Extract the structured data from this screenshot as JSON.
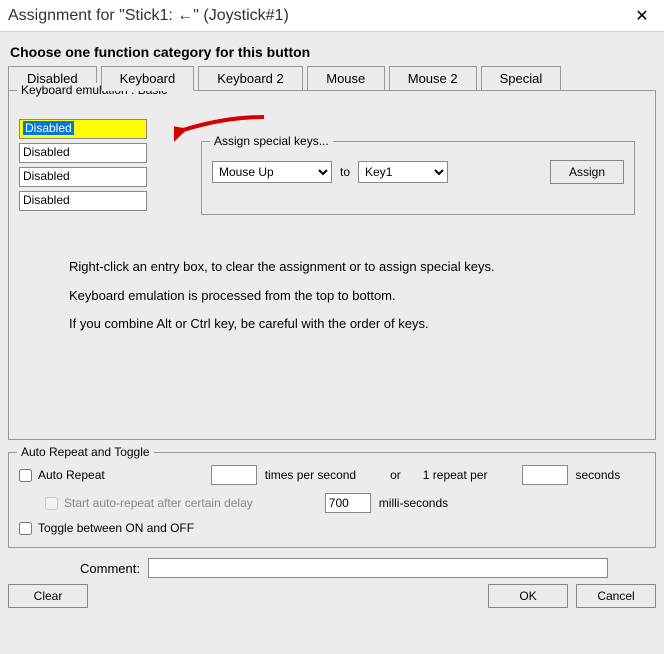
{
  "title": "Assignment for \"Stick1: ←\" (Joystick#1)",
  "heading": "Choose one function category for this button",
  "tabs": {
    "disabled": "Disabled",
    "keyboard": "Keyboard",
    "keyboard2": "Keyboard 2",
    "mouse": "Mouse",
    "mouse2": "Mouse 2",
    "special": "Special"
  },
  "kb_group_label": "Keyboard emulation : Basic",
  "entries": {
    "e1": "Disabled",
    "e2": "Disabled",
    "e3": "Disabled",
    "e4": "Disabled"
  },
  "special_group_label": "Assign special keys...",
  "special": {
    "left": "Mouse Up",
    "to": "to",
    "right": "Key1",
    "assign": "Assign"
  },
  "help": {
    "l1": "Right-click an entry box, to clear the assignment or to assign special keys.",
    "l2": "Keyboard emulation is processed from the top to bottom.",
    "l3": "If you combine Alt or Ctrl key, be careful with the order of keys."
  },
  "ar_group_label": "Auto Repeat and Toggle",
  "ar": {
    "auto_repeat": "Auto Repeat",
    "times_per_second": "times per second",
    "or": "or",
    "one_repeat_per": "1 repeat per",
    "seconds": "seconds",
    "start_delay": "Start auto-repeat after certain delay",
    "delay_value": "700",
    "milli": "milli-seconds",
    "toggle": "Toggle between ON and OFF"
  },
  "comment_label": "Comment:",
  "buttons": {
    "clear": "Clear",
    "ok": "OK",
    "cancel": "Cancel"
  }
}
